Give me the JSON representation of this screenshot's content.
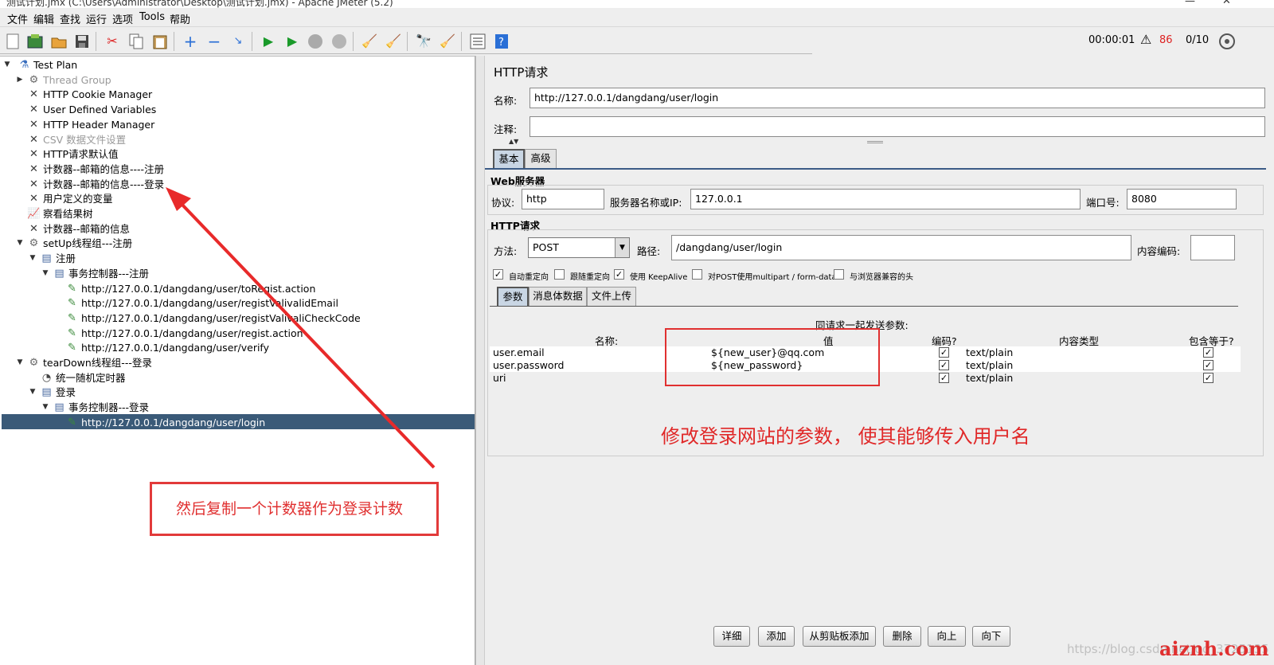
{
  "window": {
    "title": "测试计划.jmx (C:\\Users\\Administrator\\Desktop\\测试计划.jmx) - Apache JMeter (5.2)",
    "min": "—",
    "close": "✕"
  },
  "menu": [
    "文件",
    "编辑",
    "查找",
    "运行",
    "选项",
    "Tools",
    "帮助"
  ],
  "toolbar": {
    "icons": [
      "new-icon",
      "templates-icon",
      "open-icon",
      "save-icon",
      "cut-icon",
      "copy-icon",
      "paste-icon",
      "expand-icon",
      "collapse-icon",
      "toggle-icon",
      "start-icon",
      "start-no-pause-icon",
      "stop-icon",
      "shutdown-icon",
      "clear-icon",
      "clear-all-icon",
      "search-icon",
      "reset-search-icon",
      "function-helper-icon",
      "help-icon"
    ],
    "timer": "00:00:01",
    "warning_count": "86",
    "threads": "0/10"
  },
  "tree": [
    {
      "label": "Test Plan",
      "icon": "flask-icon",
      "level": 0,
      "toggle": "▼"
    },
    {
      "label": "Thread Group",
      "icon": "gear-icon",
      "level": 1,
      "toggle": "▶",
      "disabled": true
    },
    {
      "label": "HTTP Cookie Manager",
      "icon": "wrench-icon",
      "level": 1
    },
    {
      "label": "User Defined Variables",
      "icon": "wrench-icon",
      "level": 1
    },
    {
      "label": "HTTP Header Manager",
      "icon": "wrench-icon",
      "level": 1
    },
    {
      "label": "CSV 数据文件设置",
      "icon": "wrench-icon",
      "level": 1,
      "disabled": true
    },
    {
      "label": "HTTP请求默认值",
      "icon": "wrench-icon",
      "level": 1
    },
    {
      "label": "计数器--邮箱的信息----注册",
      "icon": "wrench-icon",
      "level": 1
    },
    {
      "label": "计数器--邮箱的信息----登录",
      "icon": "wrench-icon",
      "level": 1
    },
    {
      "label": "用户定义的变量",
      "icon": "wrench-icon",
      "level": 1
    },
    {
      "label": "察看结果树",
      "icon": "chart-icon",
      "level": 1
    },
    {
      "label": "计数器--邮箱的信息",
      "icon": "wrench-icon",
      "level": 1
    },
    {
      "label": "setUp线程组---注册",
      "icon": "gear-icon",
      "level": 1,
      "toggle": "▼"
    },
    {
      "label": "注册",
      "icon": "controller-icon",
      "level": 2,
      "toggle": "▼"
    },
    {
      "label": "事务控制器---注册",
      "icon": "controller-icon",
      "level": 3,
      "toggle": "▼"
    },
    {
      "label": "http://127.0.0.1/dangdang/user/toRegist.action",
      "icon": "sampler-icon",
      "level": 4
    },
    {
      "label": "http://127.0.0.1/dangdang/user/registValivalidEmail",
      "icon": "sampler-icon",
      "level": 4
    },
    {
      "label": "http://127.0.0.1/dangdang/user/registValivaliCheckCode",
      "icon": "sampler-icon",
      "level": 4
    },
    {
      "label": "http://127.0.0.1/dangdang/user/regist.action",
      "icon": "sampler-icon",
      "level": 4
    },
    {
      "label": "http://127.0.0.1/dangdang/user/verify",
      "icon": "sampler-icon",
      "level": 4
    },
    {
      "label": "tearDown线程组---登录",
      "icon": "gear-icon",
      "level": 1,
      "toggle": "▼"
    },
    {
      "label": "统一随机定时器",
      "icon": "timer-icon",
      "level": 2
    },
    {
      "label": "登录",
      "icon": "controller-icon",
      "level": 2,
      "toggle": "▼"
    },
    {
      "label": "事务控制器---登录",
      "icon": "controller-icon",
      "level": 3,
      "toggle": "▼"
    },
    {
      "label": "http://127.0.0.1/dangdang/user/login",
      "icon": "sampler-icon",
      "level": 4,
      "selected": true
    }
  ],
  "annotation": {
    "left_note": "然后复制一个计数器作为登录计数",
    "right_note": "修改登录网站的参数， 使其能够传入用户名",
    "color": "#e03030"
  },
  "panel": {
    "title": "HTTP请求",
    "name_label": "名称:",
    "name_value": "http://127.0.0.1/dangdang/user/login",
    "comment_label": "注释:",
    "comment_value": "",
    "tabs": [
      "基本",
      "高级"
    ],
    "web_server_title": "Web服务器",
    "protocol_label": "协议:",
    "protocol_value": "http",
    "server_label": "服务器名称或IP:",
    "server_value": "127.0.0.1",
    "port_label": "端口号:",
    "port_value": "8080",
    "http_request_title": "HTTP请求",
    "method_label": "方法:",
    "method_value": "POST",
    "path_label": "路径:",
    "path_value": "/dangdang/user/login",
    "encoding_label": "内容编码:",
    "encoding_value": "",
    "options": [
      {
        "label": "自动重定向",
        "checked": true
      },
      {
        "label": "跟随重定向",
        "checked": false
      },
      {
        "label": "使用 KeepAlive",
        "checked": true
      },
      {
        "label": "对POST使用multipart / form-data",
        "checked": false
      },
      {
        "label": "与浏览器兼容的头",
        "checked": false
      }
    ],
    "subtabs": [
      "参数",
      "消息体数据",
      "文件上传"
    ],
    "params_caption": "同请求一起发送参数:",
    "columns": [
      "名称:",
      "值",
      "编码?",
      "内容类型",
      "包含等于?"
    ],
    "rows": [
      {
        "name": "user.email",
        "value": "${new_user}@qq.com",
        "encode": true,
        "content_type": "text/plain",
        "include_equals": true
      },
      {
        "name": "user.password",
        "value": "${new_password}",
        "encode": true,
        "content_type": "text/plain",
        "include_equals": true
      },
      {
        "name": "uri",
        "value": "",
        "encode": true,
        "content_type": "text/plain",
        "include_equals": true
      }
    ],
    "buttons": [
      "详细",
      "添加",
      "从剪贴板添加",
      "删除",
      "向上",
      "向下"
    ]
  },
  "watermark": {
    "text": "https://blog.csdn.net/qq_3725135",
    "brand": "aiznh.com"
  }
}
